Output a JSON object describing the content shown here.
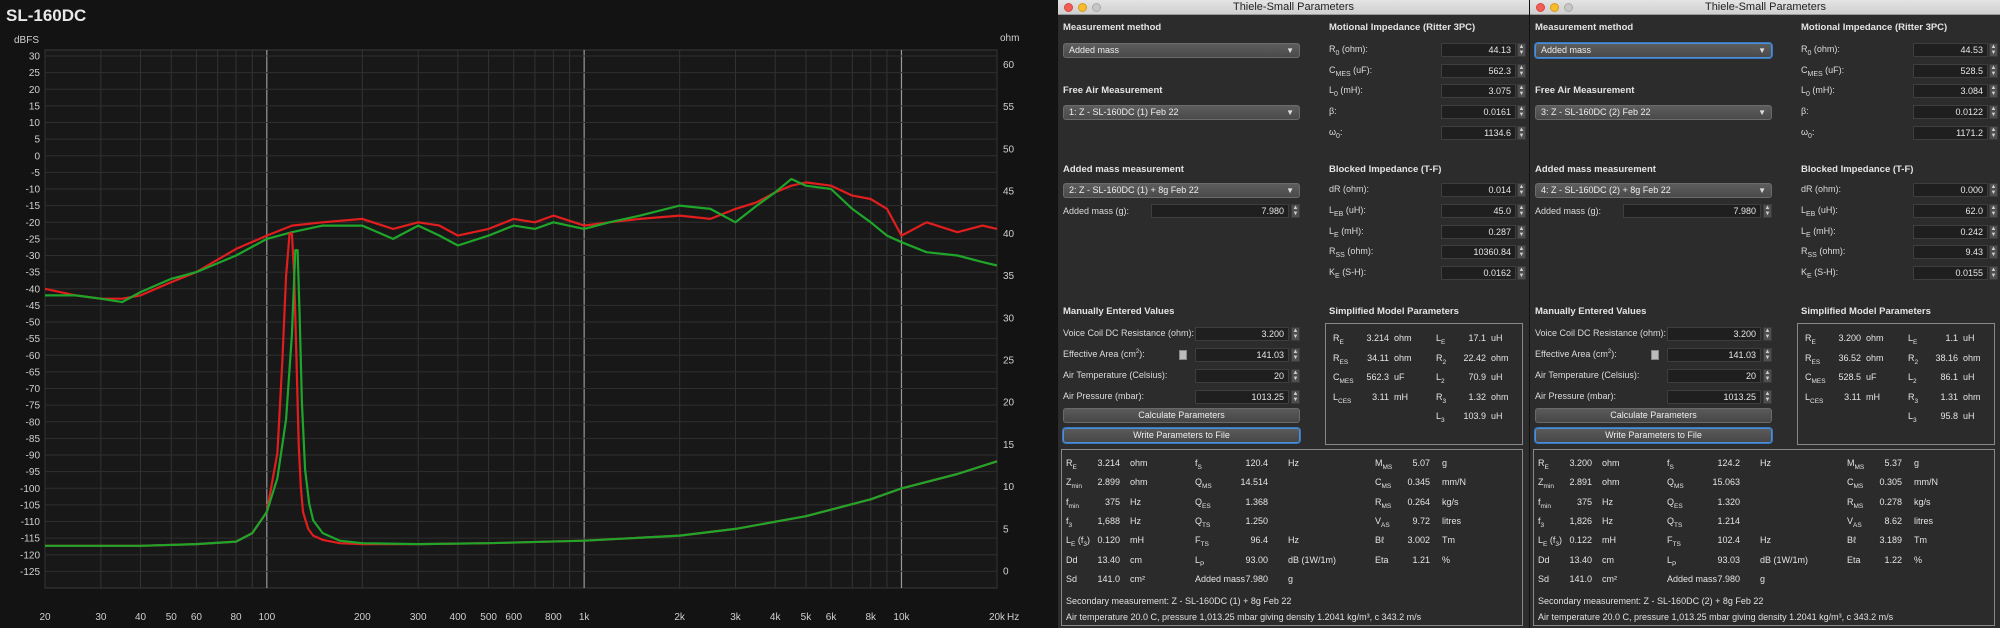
{
  "graph": {
    "title": "SL-160DC",
    "left_unit": "dBFS",
    "right_unit": "ohm",
    "x_unit": "Hz",
    "x_ticks": [
      "20",
      "30",
      "40",
      "50",
      "60",
      "80",
      "100",
      "200",
      "300",
      "400",
      "500",
      "600",
      "800",
      "1k",
      "2k",
      "3k",
      "4k",
      "5k",
      "6k",
      "8k",
      "10k",
      "20k"
    ],
    "y_left_ticks": [
      "30",
      "25",
      "20",
      "15",
      "10",
      "5",
      "0",
      "-5",
      "-10",
      "-15",
      "-20",
      "-25",
      "-30",
      "-35",
      "-40",
      "-45",
      "-50",
      "-55",
      "-60",
      "-65",
      "-70",
      "-75",
      "-80",
      "-85",
      "-90",
      "-95",
      "-100",
      "-105",
      "-110",
      "-115",
      "-120",
      "-125"
    ],
    "y_right_ticks": [
      "60",
      "55",
      "50",
      "45",
      "40",
      "35",
      "30",
      "25",
      "20",
      "15",
      "10",
      "5",
      "0"
    ],
    "colors": {
      "red": "#e01e1e",
      "green": "#1fa52a"
    }
  },
  "chart_data": {
    "type": "line",
    "xscale": "log",
    "xlim": [
      20,
      20000
    ],
    "ylim_left": [
      -130,
      30
    ],
    "ylim_right": [
      -2,
      61
    ],
    "series": [
      {
        "axis": "left",
        "color": "#e01e1e",
        "x": [
          20,
          25,
          30,
          35,
          40,
          50,
          60,
          80,
          100,
          120,
          150,
          200,
          250,
          300,
          350,
          400,
          500,
          600,
          700,
          800,
          1000,
          1200,
          1500,
          2000,
          2500,
          3000,
          3500,
          4000,
          4500,
          5000,
          6000,
          7000,
          8000,
          9000,
          10000,
          12000,
          15000,
          18000,
          20000
        ],
        "y": [
          -40,
          -42,
          -43,
          -43,
          -42,
          -38,
          -35,
          -28,
          -24,
          -21,
          -20,
          -19,
          -22,
          -20,
          -21,
          -24,
          -22,
          -19,
          -20,
          -18,
          -21,
          -20,
          -19,
          -18,
          -19,
          -16,
          -14,
          -11,
          -9,
          -8,
          -9,
          -12,
          -13,
          -16,
          -24,
          -20,
          -23,
          -21,
          -22
        ]
      },
      {
        "axis": "left",
        "color": "#1fa52a",
        "x": [
          20,
          25,
          30,
          35,
          40,
          50,
          60,
          80,
          100,
          120,
          150,
          200,
          250,
          300,
          350,
          400,
          500,
          600,
          700,
          800,
          1000,
          1200,
          1500,
          2000,
          2500,
          3000,
          3500,
          4000,
          4500,
          5000,
          6000,
          7000,
          8000,
          9000,
          10000,
          12000,
          15000,
          18000,
          20000
        ],
        "y": [
          -42,
          -42,
          -43,
          -44,
          -41,
          -37,
          -35,
          -30,
          -25,
          -23,
          -21,
          -21,
          -25,
          -21,
          -24,
          -27,
          -24,
          -21,
          -22,
          -20,
          -22,
          -20,
          -18,
          -15,
          -16,
          -20,
          -15,
          -11,
          -7,
          -9,
          -10,
          -16,
          -20,
          -24,
          -26,
          -29,
          -30,
          -32,
          -33
        ]
      },
      {
        "axis": "right",
        "color": "#e01e1e",
        "x": [
          20,
          40,
          60,
          80,
          90,
          100,
          108,
          112,
          115,
          118,
          120,
          122,
          124,
          126,
          128,
          130,
          135,
          140,
          150,
          170,
          200,
          300,
          500,
          1000,
          2000,
          3000,
          5000,
          8000,
          10000,
          15000,
          20000
        ],
        "y": [
          3,
          3,
          3.2,
          3.5,
          4.5,
          7,
          14,
          25,
          35,
          40,
          40,
          35,
          25,
          15,
          10,
          7,
          5,
          4.2,
          3.7,
          3.3,
          3.2,
          3.2,
          3.3,
          3.6,
          4.2,
          5,
          6.5,
          8.5,
          9.8,
          11.5,
          13
        ]
      },
      {
        "axis": "right",
        "color": "#1fa52a",
        "x": [
          20,
          40,
          60,
          80,
          90,
          100,
          108,
          115,
          120,
          123,
          125,
          127,
          129,
          132,
          136,
          140,
          150,
          170,
          200,
          300,
          500,
          1000,
          2000,
          3000,
          5000,
          8000,
          10000,
          15000,
          20000
        ],
        "y": [
          3,
          3,
          3.2,
          3.5,
          4.5,
          7,
          11,
          18,
          28,
          38,
          38,
          30,
          20,
          12,
          8,
          6,
          4.5,
          3.6,
          3.3,
          3.2,
          3.3,
          3.6,
          4.2,
          5,
          6.5,
          8.5,
          9.8,
          11.5,
          13
        ]
      }
    ]
  },
  "panels": [
    {
      "window_title": "Thiele-Small Parameters",
      "measurement_method_label": "Measurement method",
      "measurement_method_value": "Added mass",
      "free_air_label": "Free Air Measurement",
      "free_air_value": "1: Z - SL-160DC (1) Feb 22",
      "added_mass_meas_label": "Added mass measurement",
      "added_mass_meas_value": "2: Z - SL-160DC (1) + 8g Feb 22",
      "added_mass_g_label": "Added mass (g):",
      "added_mass_g_value": "7.980",
      "manual_label": "Manually Entered Values",
      "vc_label": "Voice Coil DC Resistance (ohm):",
      "vc_value": "3.200",
      "area_label": "Effective Area (cm",
      "area_value": "141.03",
      "temp_label": "Air Temperature (Celsius):",
      "temp_value": "20",
      "press_label": "Air Pressure (mbar):",
      "press_value": "1013.25",
      "calc_button": "Calculate Parameters",
      "write_button": "Write Parameters to File",
      "motional_label": "Motional Impedance (Ritter 3PC)",
      "motional": [
        {
          "label": "R",
          "sub": "0",
          "unit": " (ohm):",
          "value": "44.13"
        },
        {
          "label": "C",
          "sub": "MES",
          "unit": " (uF):",
          "value": "562.3"
        },
        {
          "label": "L",
          "sub": "0",
          "unit": " (mH):",
          "value": "3.075"
        },
        {
          "label": "β:",
          "sub": "",
          "unit": "",
          "value": "0.0161"
        },
        {
          "label": "ω",
          "sub": "0",
          "unit": ":",
          "value": "1134.6"
        }
      ],
      "blocked_label": "Blocked Impedance (T-F)",
      "blocked": [
        {
          "label": "dR (ohm):",
          "sub": "",
          "unit": "",
          "value": "0.014"
        },
        {
          "label": "L",
          "sub": "EB",
          "unit": " (uH):",
          "value": "45.0"
        },
        {
          "label": "L",
          "sub": "E",
          "unit": " (mH):",
          "value": "0.287"
        },
        {
          "label": "R",
          "sub": "SS",
          "unit": " (ohm):",
          "value": "10360.84"
        },
        {
          "label": "K",
          "sub": "E",
          "unit": " (S-H):",
          "value": "0.0162"
        }
      ],
      "simplified_label": "Simplified Model Parameters",
      "simplified_left": [
        {
          "sym": "R",
          "sub": "E",
          "val": "3.214",
          "unit": "ohm"
        },
        {
          "sym": "R",
          "sub": "ES",
          "val": "34.11",
          "unit": "ohm"
        },
        {
          "sym": "C",
          "sub": "MES",
          "val": "562.3",
          "unit": "uF"
        },
        {
          "sym": "L",
          "sub": "CES",
          "val": "3.11",
          "unit": "mH"
        }
      ],
      "simplified_right": [
        {
          "sym": "L",
          "sub": "E",
          "val": "17.1",
          "unit": "uH"
        },
        {
          "sym": "R",
          "sub": "2",
          "val": "22.42",
          "unit": "ohm"
        },
        {
          "sym": "L",
          "sub": "2",
          "val": "70.9",
          "unit": "uH"
        },
        {
          "sym": "R",
          "sub": "3",
          "val": "1.32",
          "unit": "ohm"
        },
        {
          "sym": "L",
          "sub": "3",
          "val": "103.9",
          "unit": "uH"
        }
      ],
      "results": [
        [
          {
            "sym": "R",
            "sub": "E",
            "val": "3.214",
            "unit": "ohm"
          },
          {
            "sym": "f",
            "sub": "S",
            "val": "120.4",
            "unit": "Hz"
          },
          {
            "sym": "M",
            "sub": "MS",
            "val": "5.07",
            "unit": "g"
          }
        ],
        [
          {
            "sym": "Z",
            "sub": "min",
            "val": "2.899",
            "unit": "ohm"
          },
          {
            "sym": "Q",
            "sub": "MS",
            "val": "14.514",
            "unit": ""
          },
          {
            "sym": "C",
            "sub": "MS",
            "val": "0.345",
            "unit": "mm/N"
          }
        ],
        [
          {
            "sym": "f",
            "sub": "min",
            "val": "375",
            "unit": "Hz"
          },
          {
            "sym": "Q",
            "sub": "ES",
            "val": "1.368",
            "unit": ""
          },
          {
            "sym": "R",
            "sub": "MS",
            "val": "0.264",
            "unit": "kg/s"
          }
        ],
        [
          {
            "sym": "f",
            "sub": "3",
            "val": "1,688",
            "unit": "Hz"
          },
          {
            "sym": "Q",
            "sub": "TS",
            "val": "1.250",
            "unit": ""
          },
          {
            "sym": "V",
            "sub": "AS",
            "val": "9.72",
            "unit": "litres"
          }
        ],
        [
          {
            "sym": "L",
            "sub": "E",
            "sym2": " (f",
            "sub2": "3",
            "sym3": ")",
            "val": "0.120",
            "unit": "mH"
          },
          {
            "sym": "F",
            "sub": "TS",
            "val": "96.4",
            "unit": "Hz"
          },
          {
            "sym": "Bℓ",
            "sub": "",
            "val": "3.002",
            "unit": "Tm"
          }
        ],
        [
          {
            "sym": "Dd",
            "sub": "",
            "val": "13.40",
            "unit": "cm"
          },
          {
            "sym": "L",
            "sub": "P",
            "val": "93.00",
            "unit": "dB (1W/1m)"
          },
          {
            "sym": "Eta",
            "sub": "",
            "val": "1.21",
            "unit": "%"
          }
        ],
        [
          {
            "sym": "Sd",
            "sub": "",
            "val": "141.0",
            "unit": "cm²"
          },
          {
            "sym": "Added mass",
            "sub": "",
            "val": "7.980",
            "unit": "g"
          },
          null
        ]
      ],
      "footer_secondary": "Secondary measurement: Z - SL-160DC (1) + 8g Feb 22",
      "footer_air": "Air temperature 20.0 C, pressure 1,013.25 mbar giving density 1.2041 kg/m³, c 343.2 m/s"
    },
    {
      "window_title": "Thiele-Small Parameters",
      "measurement_method_label": "Measurement method",
      "measurement_method_value": "Added mass",
      "free_air_label": "Free Air Measurement",
      "free_air_value": "3: Z - SL-160DC (2) Feb 22",
      "added_mass_meas_label": "Added mass measurement",
      "added_mass_meas_value": "4: Z - SL-160DC (2) + 8g Feb 22",
      "added_mass_g_label": "Added mass (g):",
      "added_mass_g_value": "7.980",
      "manual_label": "Manually Entered Values",
      "vc_label": "Voice Coil DC Resistance (ohm):",
      "vc_value": "3.200",
      "area_label": "Effective Area (cm",
      "area_value": "141.03",
      "temp_label": "Air Temperature (Celsius):",
      "temp_value": "20",
      "press_label": "Air Pressure (mbar):",
      "press_value": "1013.25",
      "calc_button": "Calculate Parameters",
      "write_button": "Write Parameters to File",
      "motional_label": "Motional Impedance (Ritter 3PC)",
      "motional": [
        {
          "label": "R",
          "sub": "0",
          "unit": " (ohm):",
          "value": "44.53"
        },
        {
          "label": "C",
          "sub": "MES",
          "unit": " (uF):",
          "value": "528.5"
        },
        {
          "label": "L",
          "sub": "0",
          "unit": " (mH):",
          "value": "3.084"
        },
        {
          "label": "β:",
          "sub": "",
          "unit": "",
          "value": "0.0122"
        },
        {
          "label": "ω",
          "sub": "0",
          "unit": ":",
          "value": "1171.2"
        }
      ],
      "blocked_label": "Blocked Impedance (T-F)",
      "blocked": [
        {
          "label": "dR (ohm):",
          "sub": "",
          "unit": "",
          "value": "0.000"
        },
        {
          "label": "L",
          "sub": "EB",
          "unit": " (uH):",
          "value": "62.0"
        },
        {
          "label": "L",
          "sub": "E",
          "unit": " (mH):",
          "value": "0.242"
        },
        {
          "label": "R",
          "sub": "SS",
          "unit": " (ohm):",
          "value": "9.43"
        },
        {
          "label": "K",
          "sub": "E",
          "unit": " (S-H):",
          "value": "0.0155"
        }
      ],
      "simplified_label": "Simplified Model Parameters",
      "simplified_left": [
        {
          "sym": "R",
          "sub": "E",
          "val": "3.200",
          "unit": "ohm"
        },
        {
          "sym": "R",
          "sub": "ES",
          "val": "36.52",
          "unit": "ohm"
        },
        {
          "sym": "C",
          "sub": "MES",
          "val": "528.5",
          "unit": "uF"
        },
        {
          "sym": "L",
          "sub": "CES",
          "val": "3.11",
          "unit": "mH"
        }
      ],
      "simplified_right": [
        {
          "sym": "L",
          "sub": "E",
          "val": "1.1",
          "unit": "uH"
        },
        {
          "sym": "R",
          "sub": "2",
          "val": "38.16",
          "unit": "ohm"
        },
        {
          "sym": "L",
          "sub": "2",
          "val": "86.1",
          "unit": "uH"
        },
        {
          "sym": "R",
          "sub": "3",
          "val": "1.31",
          "unit": "ohm"
        },
        {
          "sym": "L",
          "sub": "3",
          "val": "95.8",
          "unit": "uH"
        }
      ],
      "results": [
        [
          {
            "sym": "R",
            "sub": "E",
            "val": "3.200",
            "unit": "ohm"
          },
          {
            "sym": "f",
            "sub": "S",
            "val": "124.2",
            "unit": "Hz"
          },
          {
            "sym": "M",
            "sub": "MS",
            "val": "5.37",
            "unit": "g"
          }
        ],
        [
          {
            "sym": "Z",
            "sub": "min",
            "val": "2.891",
            "unit": "ohm"
          },
          {
            "sym": "Q",
            "sub": "MS",
            "val": "15.063",
            "unit": ""
          },
          {
            "sym": "C",
            "sub": "MS",
            "val": "0.305",
            "unit": "mm/N"
          }
        ],
        [
          {
            "sym": "f",
            "sub": "min",
            "val": "375",
            "unit": "Hz"
          },
          {
            "sym": "Q",
            "sub": "ES",
            "val": "1.320",
            "unit": ""
          },
          {
            "sym": "R",
            "sub": "MS",
            "val": "0.278",
            "unit": "kg/s"
          }
        ],
        [
          {
            "sym": "f",
            "sub": "3",
            "val": "1,826",
            "unit": "Hz"
          },
          {
            "sym": "Q",
            "sub": "TS",
            "val": "1.214",
            "unit": ""
          },
          {
            "sym": "V",
            "sub": "AS",
            "val": "8.62",
            "unit": "litres"
          }
        ],
        [
          {
            "sym": "L",
            "sub": "E",
            "sym2": " (f",
            "sub2": "3",
            "sym3": ")",
            "val": "0.122",
            "unit": "mH"
          },
          {
            "sym": "F",
            "sub": "TS",
            "val": "102.4",
            "unit": "Hz"
          },
          {
            "sym": "Bℓ",
            "sub": "",
            "val": "3.189",
            "unit": "Tm"
          }
        ],
        [
          {
            "sym": "Dd",
            "sub": "",
            "val": "13.40",
            "unit": "cm"
          },
          {
            "sym": "L",
            "sub": "P",
            "val": "93.03",
            "unit": "dB (1W/1m)"
          },
          {
            "sym": "Eta",
            "sub": "",
            "val": "1.22",
            "unit": "%"
          }
        ],
        [
          {
            "sym": "Sd",
            "sub": "",
            "val": "141.0",
            "unit": "cm²"
          },
          {
            "sym": "Added mass",
            "sub": "",
            "val": "7.980",
            "unit": "g"
          },
          null
        ]
      ],
      "footer_secondary": "Secondary measurement: Z - SL-160DC (2) + 8g Feb 22",
      "footer_air": "Air temperature 20.0 C, pressure 1,013.25 mbar giving density 1.2041 kg/m³, c 343.2 m/s"
    }
  ]
}
